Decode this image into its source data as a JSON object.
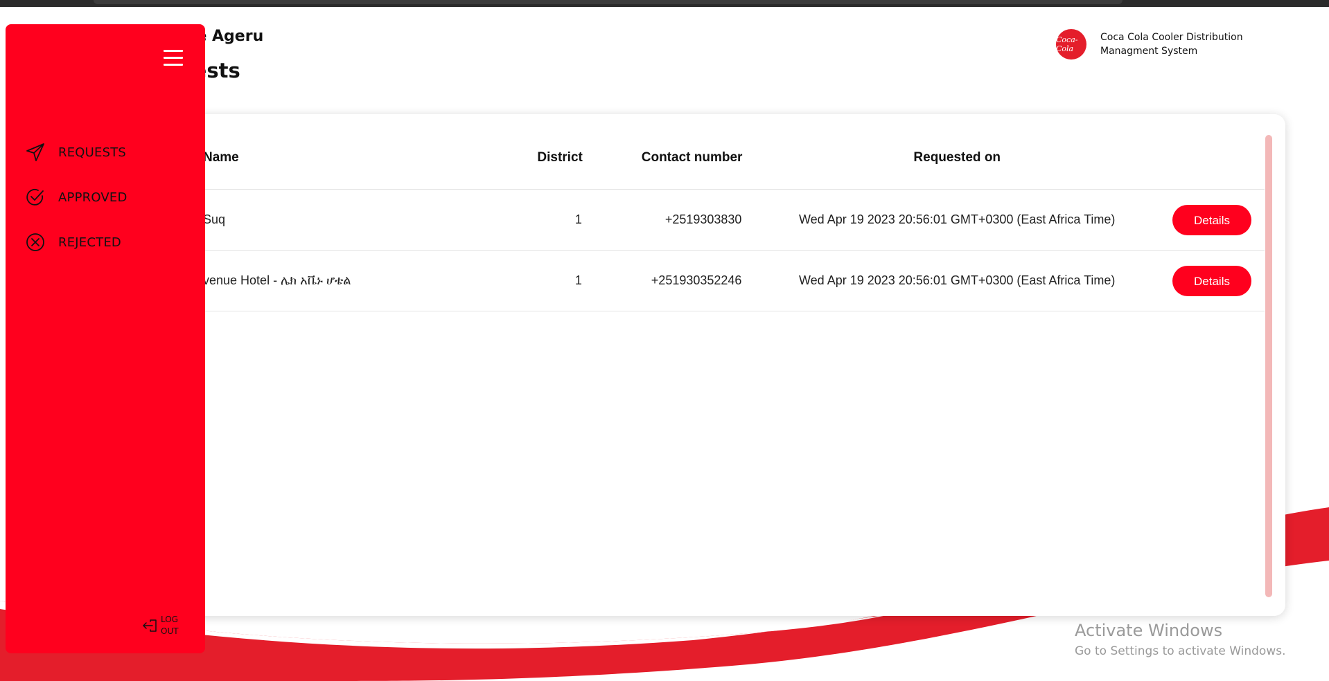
{
  "header": {
    "user_name": "ete Ageru",
    "page_title": "uests"
  },
  "brand": {
    "logo_text": "Coca-Cola",
    "system_name": "Coca Cola Cooler Distribution Managment System",
    "accent_color": "#ff001e"
  },
  "sidebar": {
    "menu_icon": "hamburger-icon",
    "items": [
      {
        "label": "REQUESTS",
        "icon": "send-icon"
      },
      {
        "label": "APPROVED",
        "icon": "check-circle-icon"
      },
      {
        "label": "REJECTED",
        "icon": "x-circle-icon"
      }
    ],
    "logout_label_line1": "LOG",
    "logout_label_line2": "OUT"
  },
  "table": {
    "columns": [
      "Name",
      "District",
      "Contact number",
      "Requested on"
    ],
    "rows": [
      {
        "name": "Suq",
        "district": "1",
        "contact": "+2519303830",
        "requested_on": "Wed Apr 19 2023 20:56:01 GMT+0300 (East Africa Time)",
        "action": "Details"
      },
      {
        "name": "venue Hotel - ሌክ አቬኑ ሆቴል",
        "district": "1",
        "contact": "+251930352246",
        "requested_on": "Wed Apr 19 2023 20:56:01 GMT+0300 (East Africa Time)",
        "action": "Details"
      }
    ]
  },
  "watermark": {
    "title": "Activate Windows",
    "subtitle": "Go to Settings to activate Windows."
  }
}
